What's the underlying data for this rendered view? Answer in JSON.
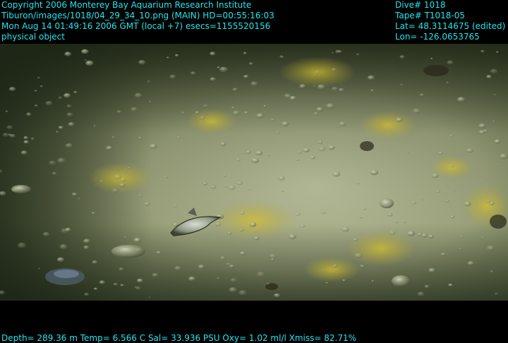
{
  "overlay": {
    "left": [
      "Copyright 2006 Monterey Bay Aquarium Research Institute",
      "Tiburon/images/1018/04_29_34_10.png (MAIN)  HD=00:55:16:03",
      "Mon Aug 14 01:49:16 2006 GMT (local +7)  esecs=1155520156",
      "physical object"
    ],
    "right": [
      "Dive# 1018",
      "Tape# T1018-05",
      "Lat= 48.3114675 (edited)",
      "Lon= -126.0653765"
    ],
    "bottom": "Depth= 289.36 m  Temp= 6.566 C  Sal= 33.936 PSU  Oxy= 1.02 ml/l  Xmiss= 82.71%"
  },
  "colors": {
    "overlay_text": "#22e6ee",
    "seafloor_light": "#b9c09a",
    "seafloor_dark": "#2b3422",
    "sulfur_patch": "#c9b636"
  },
  "scene": {
    "description_tags": [
      "seafloor",
      "sediment",
      "pebbles",
      "yellow-patches",
      "flatfish"
    ]
  }
}
